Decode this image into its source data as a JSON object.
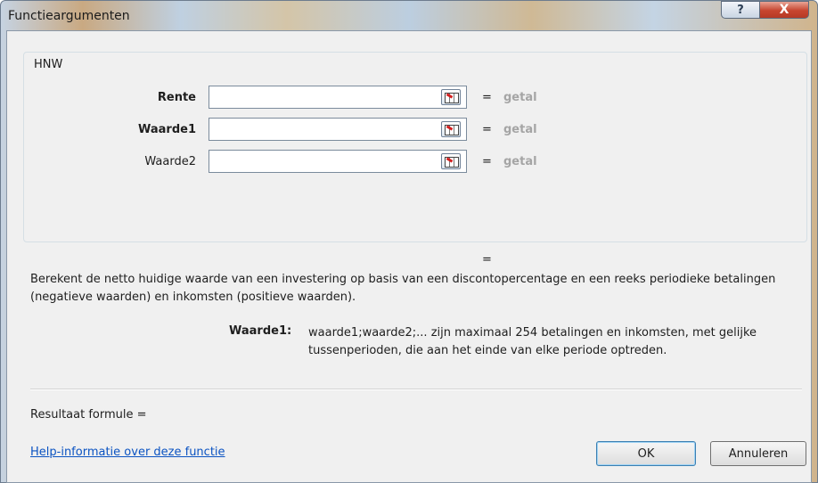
{
  "window": {
    "title": "Functieargumenten",
    "help_icon": "?",
    "close_icon": "X"
  },
  "function_group": {
    "name": "HNW",
    "arguments": [
      {
        "label": "Rente",
        "bold": true,
        "value": "",
        "equals": "=",
        "type_hint": "getal"
      },
      {
        "label": "Waarde1",
        "bold": true,
        "value": "",
        "equals": "=",
        "type_hint": "getal"
      },
      {
        "label": "Waarde2",
        "bold": false,
        "value": "",
        "equals": "=",
        "type_hint": "getal"
      }
    ],
    "ref_button_icon": "range-select-icon"
  },
  "result_equals": "=",
  "description": "Berekent de netto huidige waarde van een investering op basis van een discontopercentage en een reeks periodieke betalingen (negatieve waarden) en inkomsten (positieve waarden).",
  "argument_help": {
    "label": "Waarde1:",
    "text": "waarde1;waarde2;... zijn maximaal 254 betalingen en inkomsten, met gelijke tussenperioden, die aan het einde van elke periode optreden."
  },
  "formula_result_label": "Resultaat formule =",
  "help_link": "Help-informatie over deze functie",
  "buttons": {
    "ok": "OK",
    "cancel": "Annuleren"
  }
}
